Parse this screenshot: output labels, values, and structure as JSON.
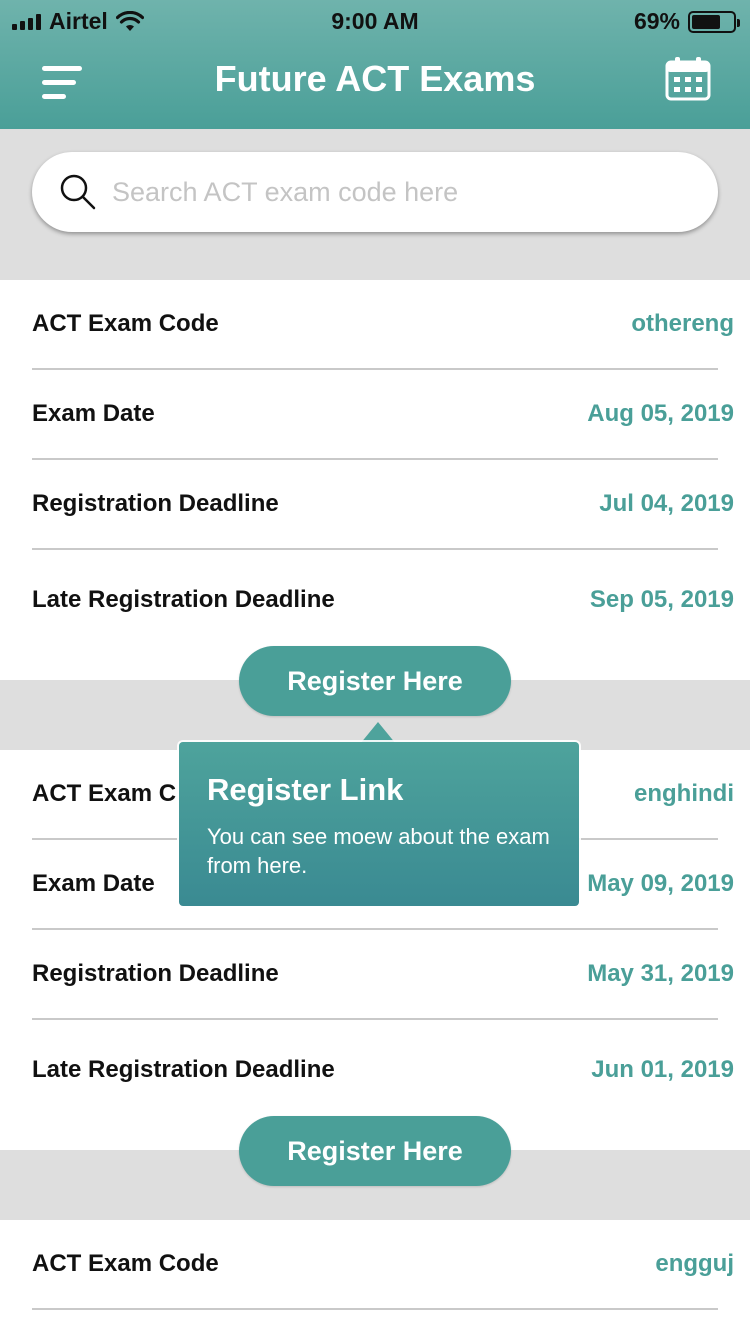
{
  "status_bar": {
    "carrier": "Airtel",
    "time": "9:00 AM",
    "battery_percent": "69%",
    "battery_level": 0.69
  },
  "header": {
    "title": "Future ACT Exams",
    "menu_icon": "hamburger-menu-icon",
    "calendar_icon": "calendar-icon"
  },
  "search": {
    "placeholder": "Search ACT exam code here",
    "value": ""
  },
  "exams": [
    {
      "rows": [
        {
          "label": "ACT Exam Code",
          "value": "othereng"
        },
        {
          "label": "Exam Date",
          "value": "Aug 05, 2019"
        },
        {
          "label": "Registration Deadline",
          "value": "Jul 04, 2019"
        },
        {
          "label": "Late Registration Deadline",
          "value": "Sep 05, 2019"
        }
      ],
      "button": "Register Here"
    },
    {
      "rows": [
        {
          "label": "ACT Exam C",
          "value": "enghindi"
        },
        {
          "label": "Exam Date",
          "value": "May 09, 2019"
        },
        {
          "label": "Registration Deadline",
          "value": "May 31, 2019"
        },
        {
          "label": "Late Registration Deadline",
          "value": "Jun 01, 2019"
        }
      ],
      "button": "Register Here"
    },
    {
      "rows": [
        {
          "label": "ACT Exam Code",
          "value": "engguj"
        }
      ]
    }
  ],
  "tooltip": {
    "title": "Register Link",
    "body": "You can see moew about the exam from here."
  },
  "colors": {
    "accent": "#4a9f98",
    "header_top": "#6fb3ac",
    "background": "#dedede"
  }
}
